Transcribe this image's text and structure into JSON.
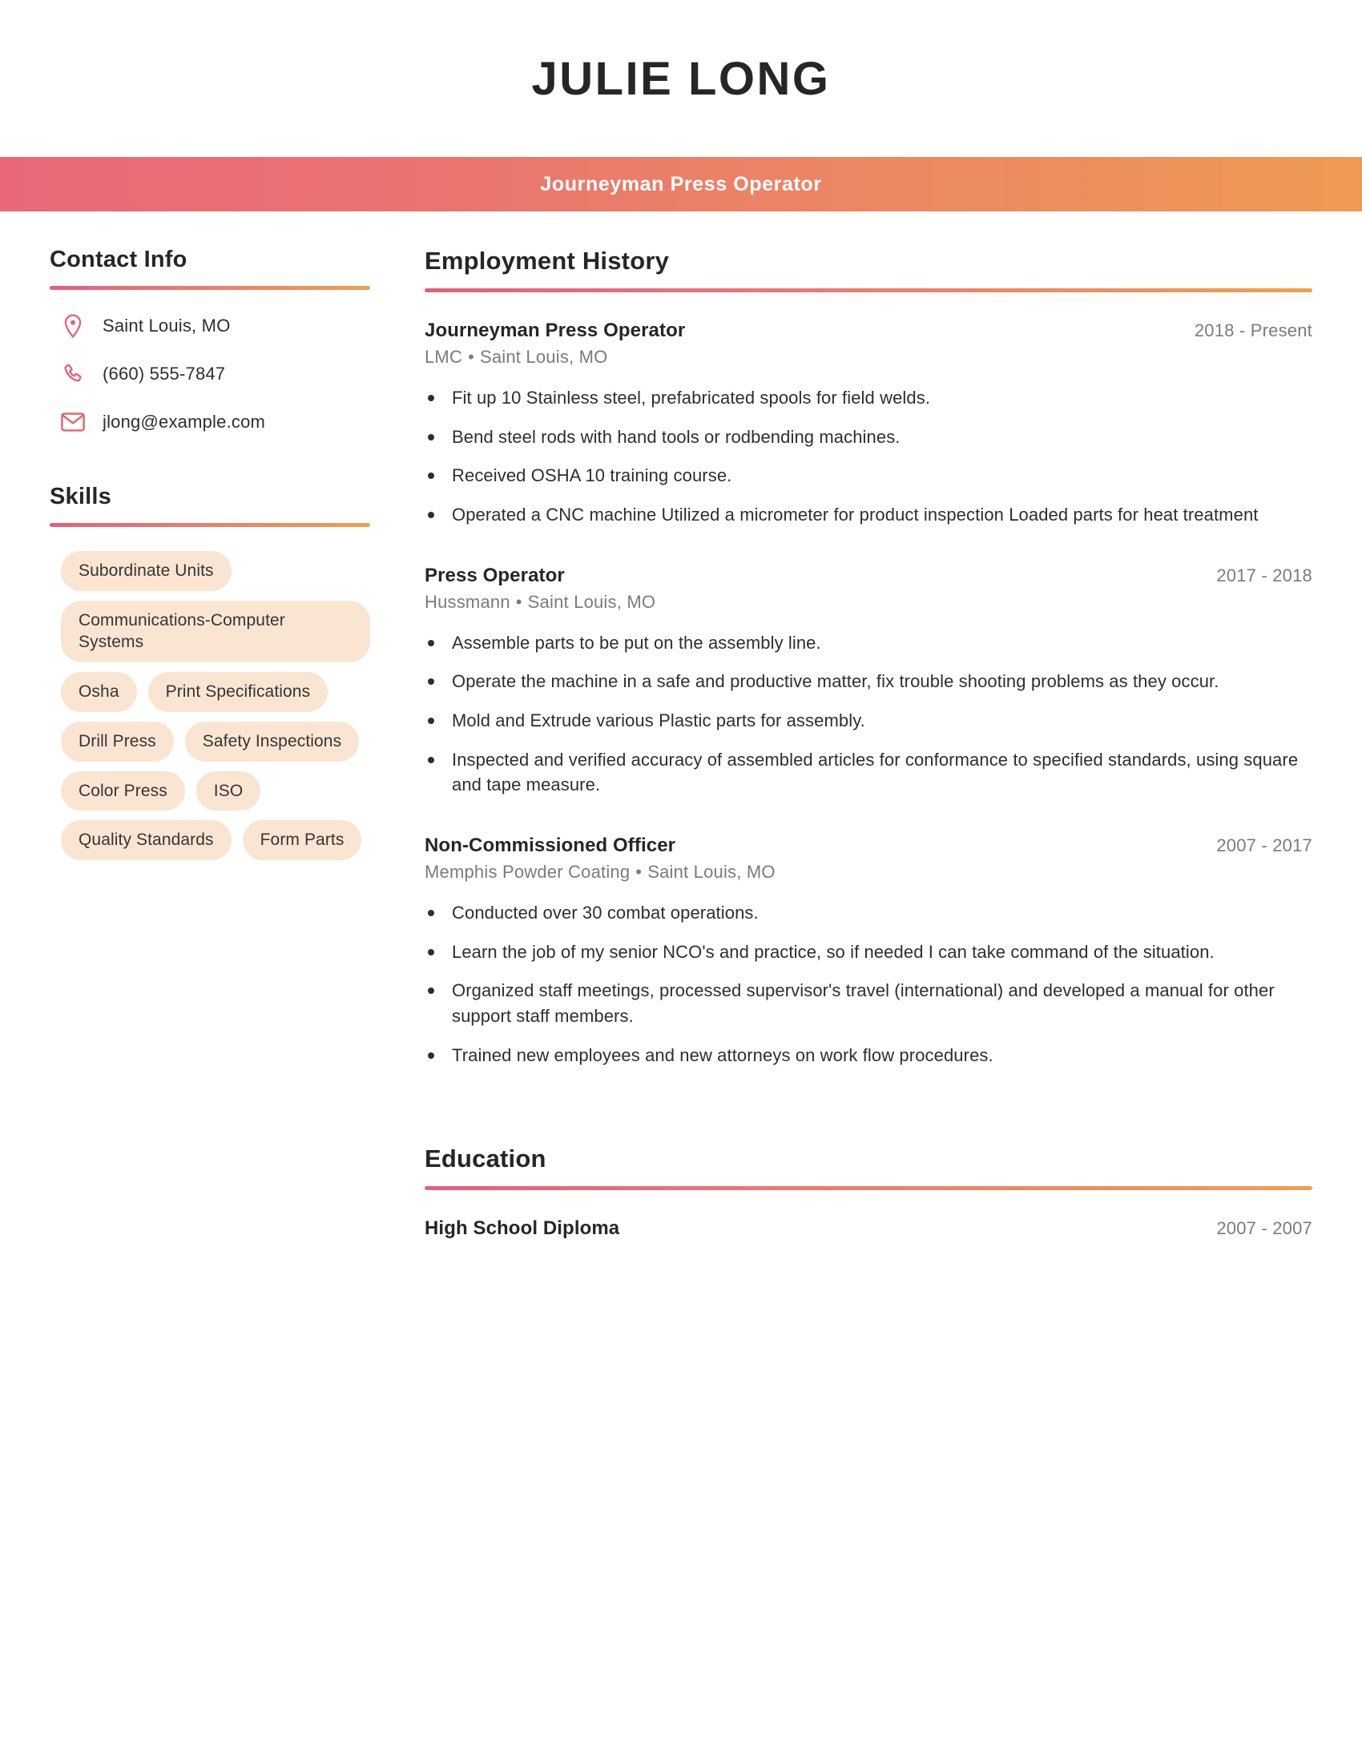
{
  "header": {
    "name": "JULIE LONG",
    "title": "Journeyman Press Operator",
    "gradient_start": "#e8687a",
    "gradient_end": "#ee9a55"
  },
  "sidebar": {
    "contact": {
      "heading": "Contact Info",
      "items": [
        {
          "icon": "location-pin-icon",
          "value": "Saint Louis, MO"
        },
        {
          "icon": "phone-icon",
          "value": "(660) 555-7847"
        },
        {
          "icon": "envelope-icon",
          "value": "jlong@example.com"
        }
      ]
    },
    "skills": {
      "heading": "Skills",
      "pill_color": "#fae5d3",
      "items": [
        {
          "label": "Subordinate Units",
          "wide": false
        },
        {
          "label": "Communications-Computer Systems",
          "wide": true
        },
        {
          "label": "Osha",
          "wide": false
        },
        {
          "label": "Print Specifications",
          "wide": false
        },
        {
          "label": "Drill Press",
          "wide": false
        },
        {
          "label": "Safety Inspections",
          "wide": false
        },
        {
          "label": "Color Press",
          "wide": false
        },
        {
          "label": "ISO",
          "wide": false
        },
        {
          "label": "Quality Standards",
          "wide": false
        },
        {
          "label": "Form Parts",
          "wide": false
        }
      ]
    }
  },
  "main": {
    "employment": {
      "heading": "Employment History",
      "jobs": [
        {
          "title": "Journeyman Press Operator",
          "dates": "2018 - Present",
          "company": "LMC",
          "location": "Saint Louis, MO",
          "bullets": [
            "Fit up 10 Stainless steel, prefabricated spools for field welds.",
            "Bend steel rods with hand tools or rodbending machines.",
            "Received OSHA 10 training course.",
            "Operated a CNC machine Utilized a micrometer for product inspection Loaded parts for heat treatment"
          ]
        },
        {
          "title": "Press Operator",
          "dates": "2017 - 2018",
          "company": "Hussmann",
          "location": "Saint Louis, MO",
          "bullets": [
            "Assemble parts to be put on the assembly line.",
            "Operate the machine in a safe and productive matter, fix trouble shooting problems as they occur.",
            "Mold and Extrude various Plastic parts for assembly.",
            "Inspected and verified accuracy of assembled articles for conformance to specified standards, using square and tape measure."
          ]
        },
        {
          "title": "Non-Commissioned Officer",
          "dates": "2007 - 2017",
          "company": "Memphis Powder Coating",
          "location": "Saint Louis, MO",
          "bullets": [
            "Conducted over 30 combat operations.",
            "Learn the job of my senior NCO's and practice, so if needed I can take command of the situation.",
            "Organized staff meetings, processed supervisor's travel (international) and developed a manual for other support staff members.",
            "Trained new employees and new attorneys on work flow procedures."
          ]
        }
      ]
    },
    "education": {
      "heading": "Education",
      "entries": [
        {
          "degree": "High School Diploma",
          "dates": "2007 - 2007"
        }
      ]
    }
  }
}
